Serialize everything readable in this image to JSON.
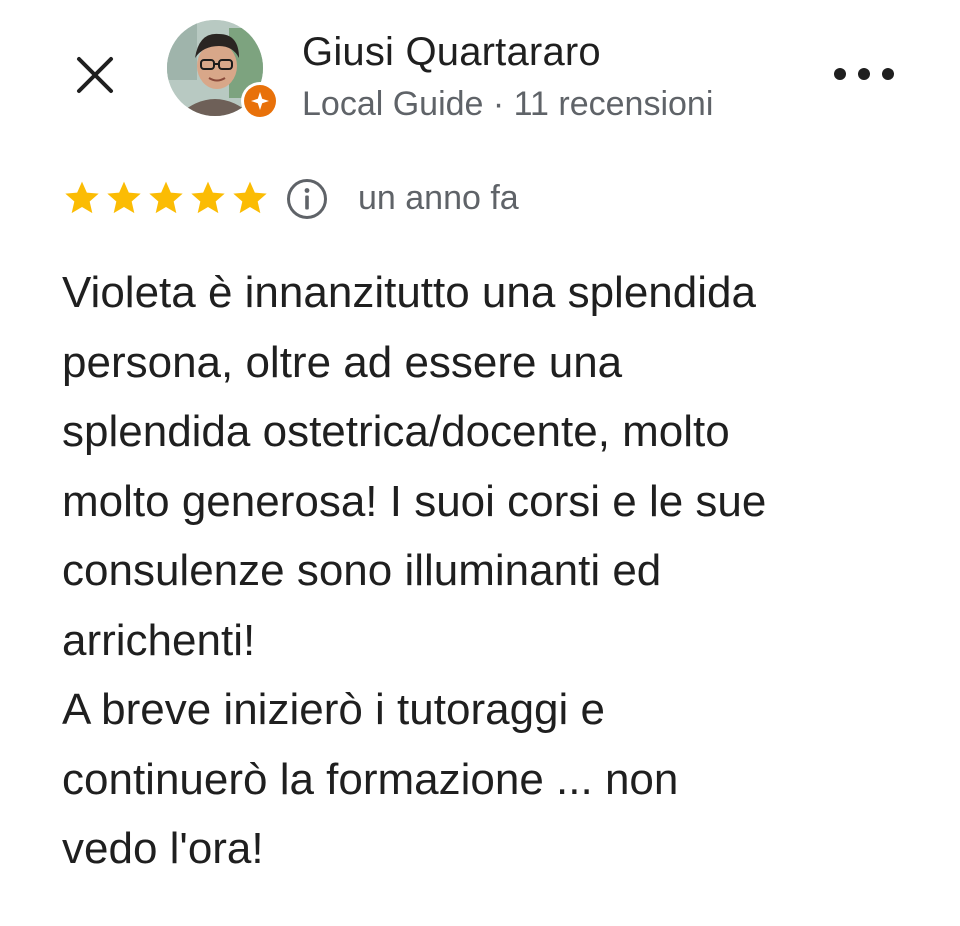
{
  "header": {
    "close_icon": "close-icon",
    "more_icon": "more-horiz-icon",
    "author": {
      "name": "Giusi Quartararo",
      "meta": "Local Guide · 11 recensioni",
      "badge_icon": "local-guide-star-icon",
      "badge_color": "#e8710a"
    }
  },
  "review": {
    "rating": 5,
    "max_rating": 5,
    "star_color": "#fbbc04",
    "info_icon": "info-icon",
    "date": "un anno fa",
    "lines": [
      "Violeta è innanzitutto una splendida",
      "persona, oltre ad essere una",
      "splendida ostetrica/docente, molto",
      "molto generosa! I suoi corsi e le sue",
      "consulenze sono illuminanti ed",
      "arrichenti!",
      "A breve inizierò i tutoraggi e",
      "continuerò la formazione ... non",
      "vedo l'ora!"
    ]
  }
}
